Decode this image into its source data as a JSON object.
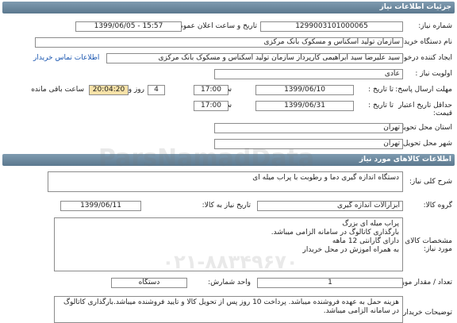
{
  "header": {
    "title": "جزئیات اطلاعات نیاز"
  },
  "need": {
    "number_label": "شماره نیاز:",
    "number": "1299003101000065",
    "announce_label": "تاریخ و ساعت اعلان عمومی:",
    "announce": "1399/06/05 - 15:57",
    "buyer_label": "نام دستگاه خریدار:",
    "buyer": "سازمان تولید اسکناس و مسکوک بانک مرکزی",
    "creator_label": "ایجاد کننده درخواست:",
    "creator": "سید علیرضا سید ابراهیمی کارپرداز سازمان تولید اسکناس و مسکوک بانک مرکزی",
    "contact_link": "اطلاعات تماس خریدار",
    "priority_label": "اولویت نیاز :",
    "priority": "عادی",
    "send_deadline_label": "مهلت ارسال پاسخ:",
    "to_date_label": "تا تاریخ :",
    "send_date": "1399/06/10",
    "time_label": "ساعت",
    "send_time": "17:00",
    "days": "4",
    "days_label": "روز و",
    "remaining": "20:04:20",
    "remaining_label": "ساعت باقی مانده",
    "validity_label": "حداقل تاریخ اعتبار قیمت:",
    "validity_date": "1399/06/31",
    "validity_time": "17:00",
    "province_label": "استان محل تحویل:",
    "province": "تهران",
    "city_label": "شهر محل تحویل:",
    "city": "تهران"
  },
  "goods_header": {
    "title": "اطلاعات کالاهای مورد نیاز"
  },
  "goods": {
    "summary_label": "شرح کلی نیاز:",
    "summary": "دستگاه اندازه گیری دما و رطوبت با پراب میله ای",
    "group_label": "گروه کالا:",
    "group": "ابزارآلات اندازه گیری",
    "need_date_label": "تاریخ نیاز به کالا:",
    "need_date": "1399/06/11",
    "specs_label": "مشخصات کالای مورد نیاز:",
    "specs": "پراب میله ای بزرگ\nبارگذاری کاتالوگ در سامانه الزامی میباشد.\nدارای گارانتی 12 ماهه\nبه همراه اموزش در محل خریدار",
    "qty_label": "تعداد / مقدار مورد نیاز:",
    "qty": "1",
    "unit_label": "واحد شمارش:",
    "unit": "دستگاه",
    "notes_label": "توضیحات خریدار:",
    "notes": "هزینه حمل به عهده فروشنده میباشد. پرداخت 10 روز پس از تحویل کالا و تایید فروشنده میباشد.بارگذاری کاتالوگ در سامانه الزامی میباشد."
  },
  "watermark": {
    "line1": "ParsNamadData",
    "line2": "۰۲۱-۸۸۳۴۹۶۷۰"
  }
}
